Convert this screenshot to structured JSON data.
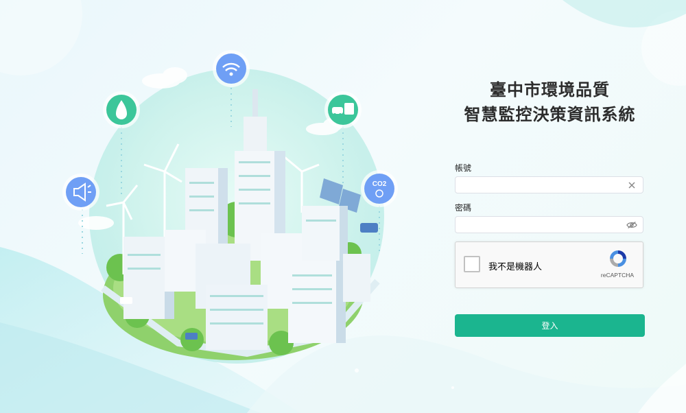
{
  "title": {
    "line1": "臺中市環境品質",
    "line2": "智慧監控決策資訊系統"
  },
  "form": {
    "account_label": "帳號",
    "account_value": "",
    "password_label": "密碼",
    "password_value": "",
    "login_label": "登入"
  },
  "captcha": {
    "label": "我不是機器人",
    "brand": "reCAPTCHA"
  },
  "illustration": {
    "co2_text": "CO2",
    "icons": [
      "speaker-icon",
      "water-drop-icon",
      "wifi-icon",
      "vehicles-icon",
      "co2-icon"
    ]
  },
  "colors": {
    "accent": "#1bb58f",
    "icon_blue": "#6f9ff5",
    "icon_green": "#3cc69a"
  }
}
